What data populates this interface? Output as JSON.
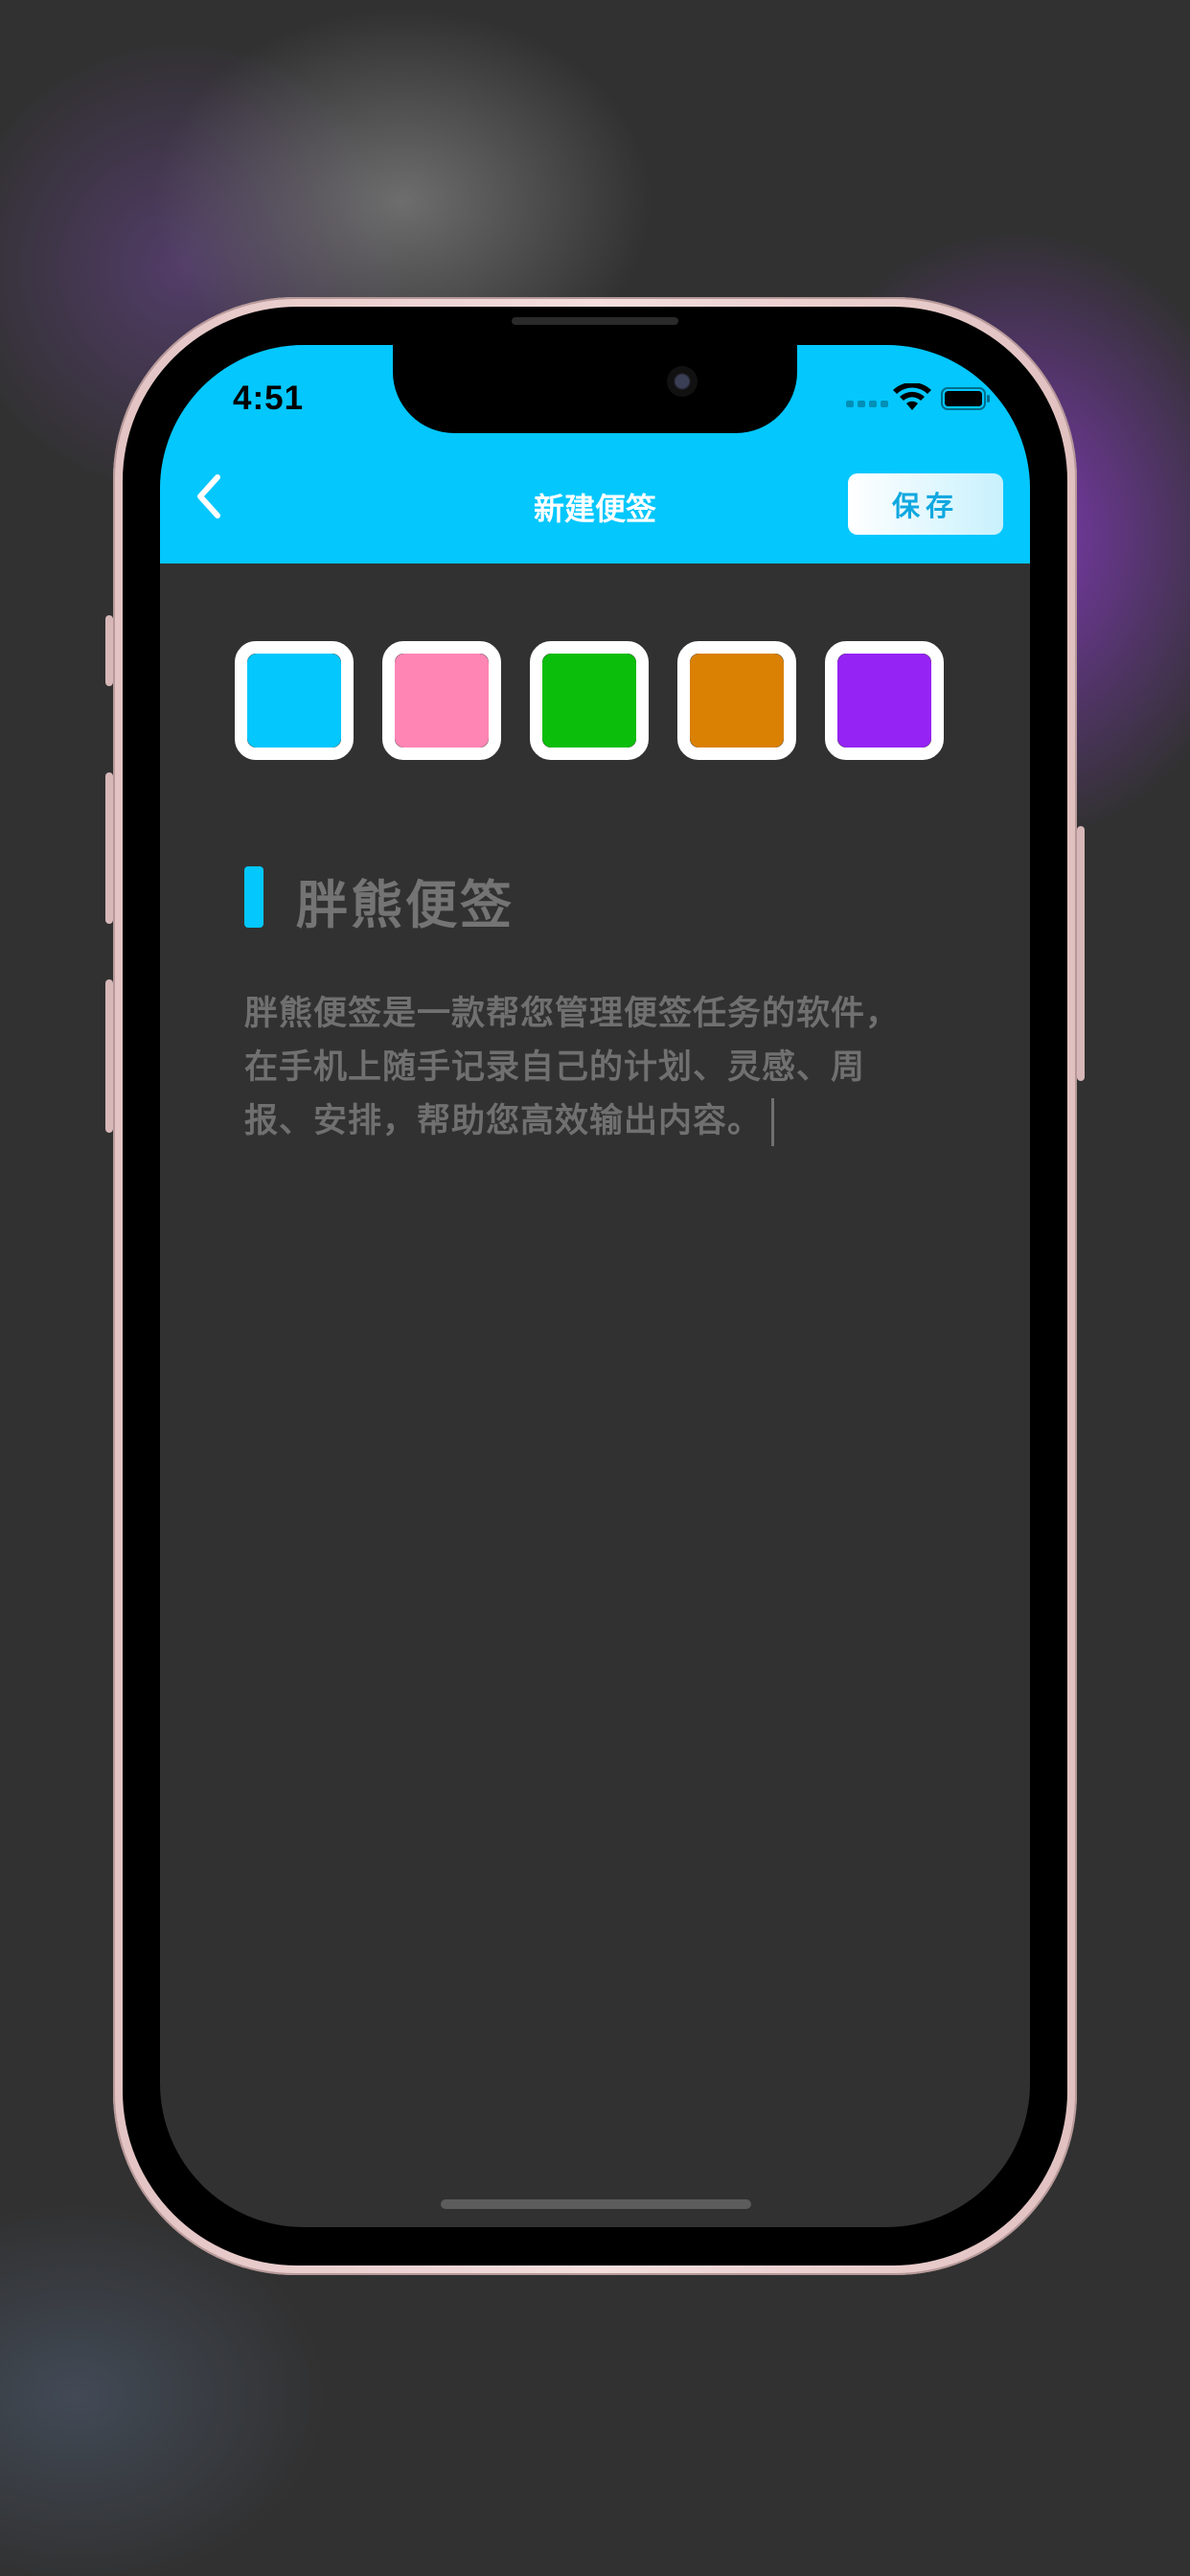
{
  "status_bar": {
    "time": "4:51",
    "icons": [
      "cellular-signal-icon",
      "wifi-icon",
      "battery-icon"
    ]
  },
  "nav": {
    "back_icon": "chevron-left-icon",
    "title": "新建便签",
    "save_label": "保存"
  },
  "colors": {
    "accent": "#03C7FD",
    "background": "#313131",
    "swatches": [
      "#03C7FD",
      "#FF85B5",
      "#0BBE0B",
      "#DA8003",
      "#9523F3"
    ]
  },
  "note": {
    "title": "胖熊便签",
    "body": "胖熊便签是一款帮您管理便签任务的软件，在手机上随手记录自己的计划、灵感、周报、安排，帮助您高效输出内容。"
  }
}
